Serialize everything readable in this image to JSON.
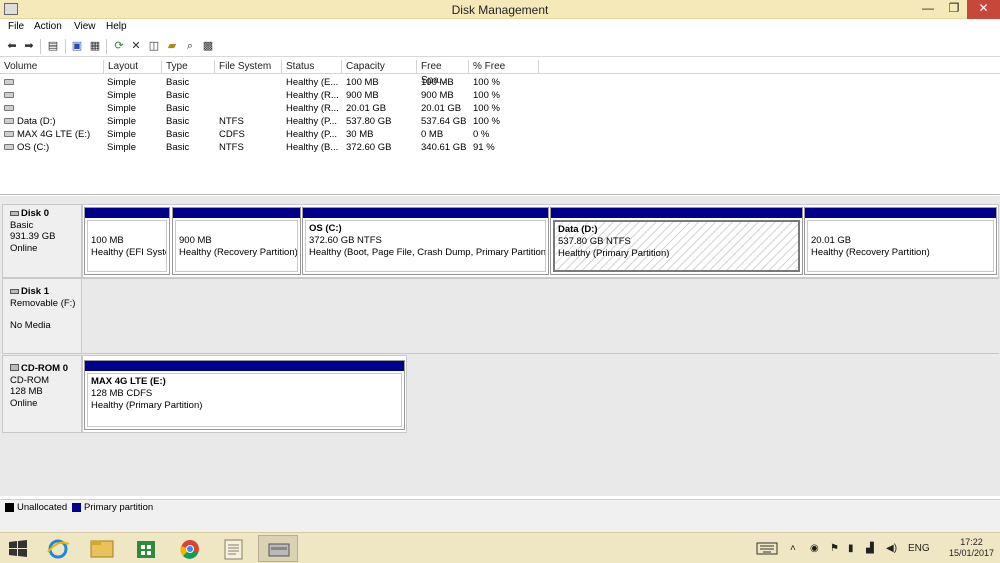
{
  "window": {
    "title": "Disk Management",
    "min": "—",
    "max": "❐",
    "close": "✕"
  },
  "menu": [
    "File",
    "Action",
    "View",
    "Help"
  ],
  "volume_table": {
    "headers": [
      "Volume",
      "Layout",
      "Type",
      "File System",
      "Status",
      "Capacity",
      "Free Spa...",
      "% Free"
    ],
    "rows": [
      {
        "volume": "",
        "layout": "Simple",
        "type": "Basic",
        "fs": "",
        "status": "Healthy (E...",
        "capacity": "100 MB",
        "free": "100 MB",
        "pct": "100 %"
      },
      {
        "volume": "",
        "layout": "Simple",
        "type": "Basic",
        "fs": "",
        "status": "Healthy (R...",
        "capacity": "900 MB",
        "free": "900 MB",
        "pct": "100 %"
      },
      {
        "volume": "",
        "layout": "Simple",
        "type": "Basic",
        "fs": "",
        "status": "Healthy (R...",
        "capacity": "20.01 GB",
        "free": "20.01 GB",
        "pct": "100 %"
      },
      {
        "volume": "Data (D:)",
        "layout": "Simple",
        "type": "Basic",
        "fs": "NTFS",
        "status": "Healthy (P...",
        "capacity": "537.80 GB",
        "free": "537.64 GB",
        "pct": "100 %"
      },
      {
        "volume": "MAX 4G LTE (E:)",
        "layout": "Simple",
        "type": "Basic",
        "fs": "CDFS",
        "status": "Healthy (P...",
        "capacity": "30 MB",
        "free": "0 MB",
        "pct": "0 %"
      },
      {
        "volume": "OS (C:)",
        "layout": "Simple",
        "type": "Basic",
        "fs": "NTFS",
        "status": "Healthy (B...",
        "capacity": "372.60 GB",
        "free": "340.61 GB",
        "pct": "91 %"
      }
    ]
  },
  "disks": {
    "disk0": {
      "name": "Disk 0",
      "type": "Basic",
      "size": "931.39 GB",
      "state": "Online"
    },
    "disk1": {
      "name": "Disk 1",
      "type": "Removable (F:)",
      "state": "No Media"
    },
    "cdrom0": {
      "name": "CD-ROM 0",
      "type": "CD-ROM",
      "size": "128 MB",
      "state": "Online"
    }
  },
  "partitions": {
    "efi": {
      "size": "100 MB",
      "status": "Healthy (EFI System Partition)"
    },
    "rec1": {
      "size": "900 MB",
      "status": "Healthy (Recovery Partition)"
    },
    "os": {
      "name": "OS  (C:)",
      "size": "372.60 GB NTFS",
      "status": "Healthy (Boot, Page File, Crash Dump, Primary Partition)"
    },
    "data": {
      "name": "Data  (D:)",
      "size": "537.80 GB NTFS",
      "status": "Healthy (Primary Partition)"
    },
    "rec2": {
      "size": "20.01 GB",
      "status": "Healthy (Recovery Partition)"
    },
    "cd": {
      "name": "MAX 4G LTE  (E:)",
      "size": "128 MB CDFS",
      "status": "Healthy (Primary Partition)"
    }
  },
  "legend": {
    "unallocated": "Unallocated",
    "primary": "Primary partition"
  },
  "colors": {
    "unallocated": "#000000",
    "primary": "#00008c",
    "titlebar": "#f6e9b9",
    "taskbar": "#efe7c4"
  },
  "taskbar": {
    "lang": "ENG",
    "time": "17:22",
    "date": "15/01/2017",
    "apps": [
      "start-icon",
      "internet-explorer-icon",
      "file-explorer-icon",
      "store-icon",
      "chrome-icon",
      "notepad-icon",
      "disk-management-icon"
    ]
  }
}
